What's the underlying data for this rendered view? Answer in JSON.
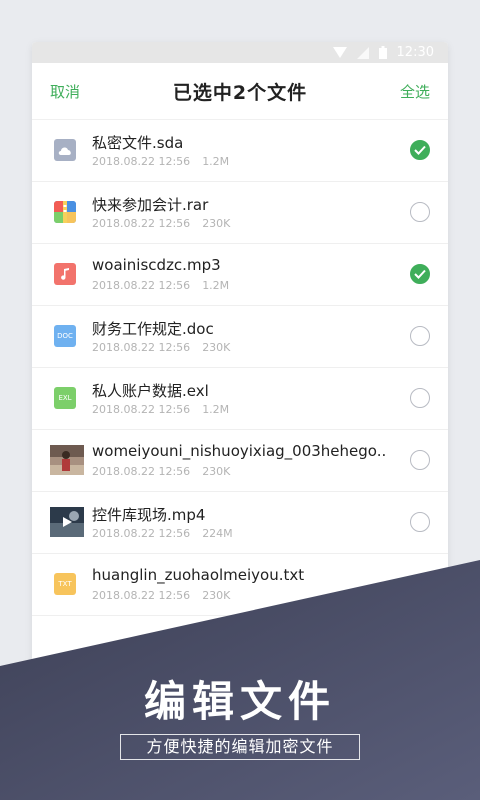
{
  "statusbar": {
    "time": "12:30"
  },
  "appbar": {
    "cancel": "取消",
    "title": "已选中2个文件",
    "select_all": "全选"
  },
  "files": [
    {
      "name": "私密文件.sda",
      "date": "2018.08.22 12:56",
      "size": "1.2M",
      "selected": true,
      "icon": "cloud-file-icon",
      "color": "#a7b0c4"
    },
    {
      "name": "快来参加会计.rar",
      "date": "2018.08.22 12:56",
      "size": "230K",
      "selected": false,
      "icon": "archive-file-icon",
      "color": "#4a90e2"
    },
    {
      "name": "woainiscdzc.mp3",
      "date": "2018.08.22 12:56",
      "size": "1.2M",
      "selected": true,
      "icon": "music-file-icon",
      "color": "#f2736c"
    },
    {
      "name": "财务工作规定.doc",
      "date": "2018.08.22 12:56",
      "size": "230K",
      "selected": false,
      "icon": "doc-file-icon",
      "color": "#6fb1f0",
      "label": "DOC"
    },
    {
      "name": "私人账户数据.exl",
      "date": "2018.08.22 12:56",
      "size": "1.2M",
      "selected": false,
      "icon": "excel-file-icon",
      "color": "#7ccf6a",
      "label": "EXL"
    },
    {
      "name": "womeiyouni_nishuoyixiag_003hehego..",
      "date": "2018.08.22 12:56",
      "size": "230K",
      "selected": false,
      "icon": "image-thumbnail-icon",
      "color": "#8a6a5a"
    },
    {
      "name": "控件库现场.mp4",
      "date": "2018.08.22 12:56",
      "size": "224M",
      "selected": false,
      "icon": "video-thumbnail-icon",
      "color": "#334455"
    },
    {
      "name": "huanglin_zuohaolmeiyou.txt",
      "date": "2018.08.22 12:56",
      "size": "230K",
      "selected": false,
      "icon": "txt-file-icon",
      "color": "#f7c45c",
      "label": "TXT"
    }
  ],
  "banner": {
    "title": "编辑文件",
    "subtitle": "方便快捷的编辑加密文件"
  },
  "colors": {
    "accent": "#3fae5a",
    "banner": "#4a4e66"
  }
}
